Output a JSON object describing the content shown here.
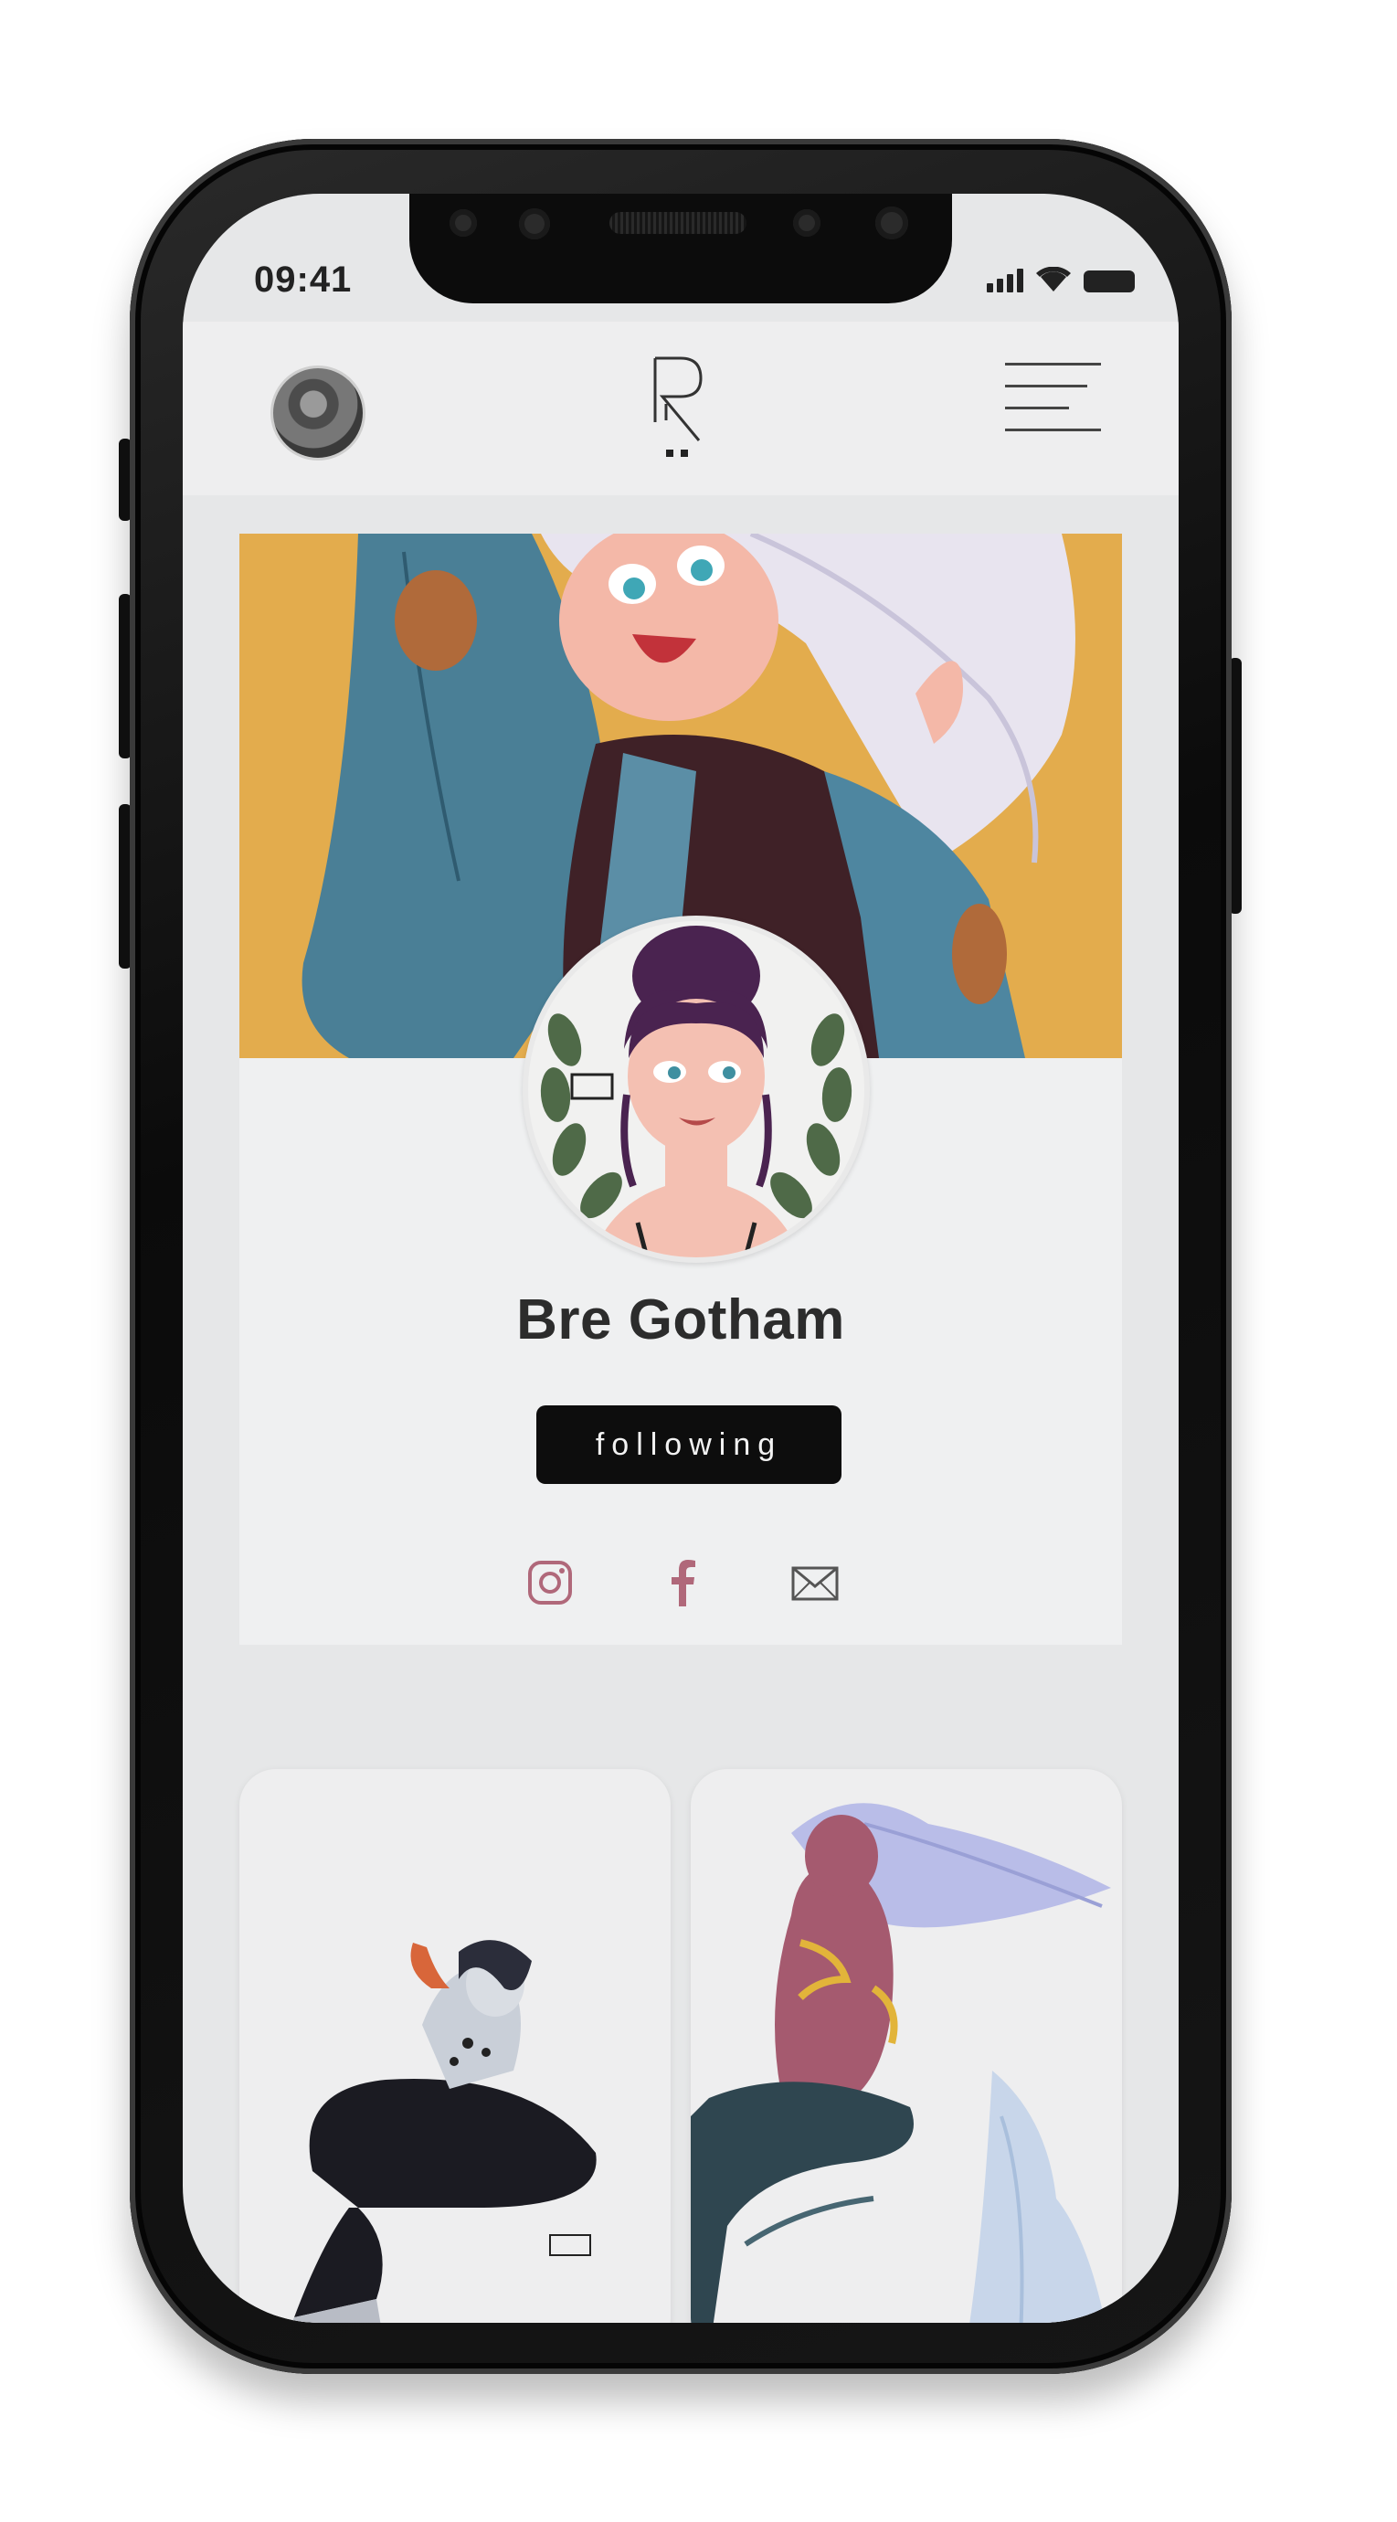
{
  "status_bar": {
    "time": "09:41"
  },
  "header": {
    "avatar_icon": "user-avatar",
    "logo_icon": "app-logo-R",
    "menu_icon": "hamburger-menu-icon"
  },
  "profile": {
    "name": "Bre Gotham",
    "follow_label": "following",
    "cover_color": "#e3ac4d",
    "social": [
      {
        "icon": "instagram-icon",
        "color": "#b0687a"
      },
      {
        "icon": "facebook-icon",
        "color": "#b0687a"
      },
      {
        "icon": "mail-icon",
        "color": "#555555"
      }
    ]
  },
  "gallery": {
    "items": [
      {
        "name": "artwork-mermaid-dark"
      },
      {
        "name": "artwork-mermaid-purple"
      }
    ]
  },
  "colors": {
    "button_bg": "#0d0d0d",
    "accent": "#b0687a",
    "screen_bg": "#e6e7e8"
  }
}
